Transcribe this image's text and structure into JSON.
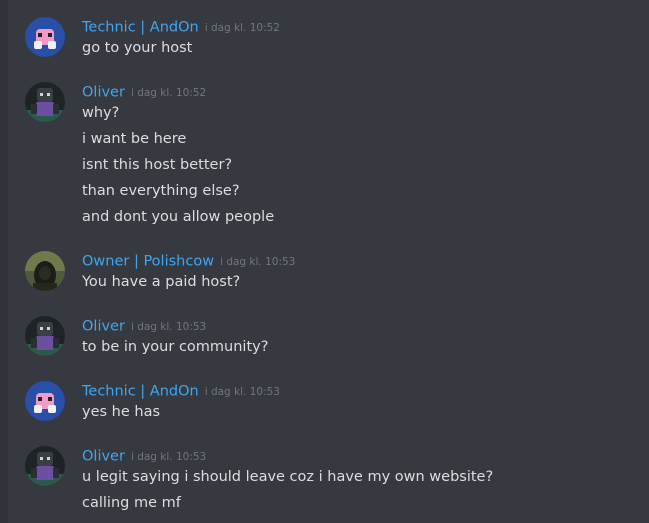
{
  "colors": {
    "background": "#36393f",
    "text": "#dcddde",
    "username": "#3fa6f3",
    "timestamp": "#72767d"
  },
  "messages": [
    {
      "author": "Technic | AndOn",
      "timestamp": "i dag kl. 10:52",
      "avatar": "avatar-pink-character",
      "lines": [
        "go to your host"
      ]
    },
    {
      "author": "Oliver",
      "timestamp": "i dag kl. 10:52",
      "avatar": "avatar-dark-character",
      "lines": [
        "why?",
        "i want be here",
        "isnt this host better?",
        "than everything else?",
        "and dont you allow people"
      ]
    },
    {
      "author": "Owner | Polishcow",
      "timestamp": "i dag kl. 10:53",
      "avatar": "avatar-green-hooded",
      "lines": [
        "You have a paid host?"
      ]
    },
    {
      "author": "Oliver",
      "timestamp": "i dag kl. 10:53",
      "avatar": "avatar-dark-character",
      "lines": [
        "to be in your community?"
      ]
    },
    {
      "author": "Technic | AndOn",
      "timestamp": "i dag kl. 10:53",
      "avatar": "avatar-pink-character",
      "lines": [
        "yes he has"
      ]
    },
    {
      "author": "Oliver",
      "timestamp": "i dag kl. 10:53",
      "avatar": "avatar-dark-character",
      "lines": [
        "u legit saying i should leave coz i have my own website?",
        "calling me mf"
      ]
    }
  ]
}
